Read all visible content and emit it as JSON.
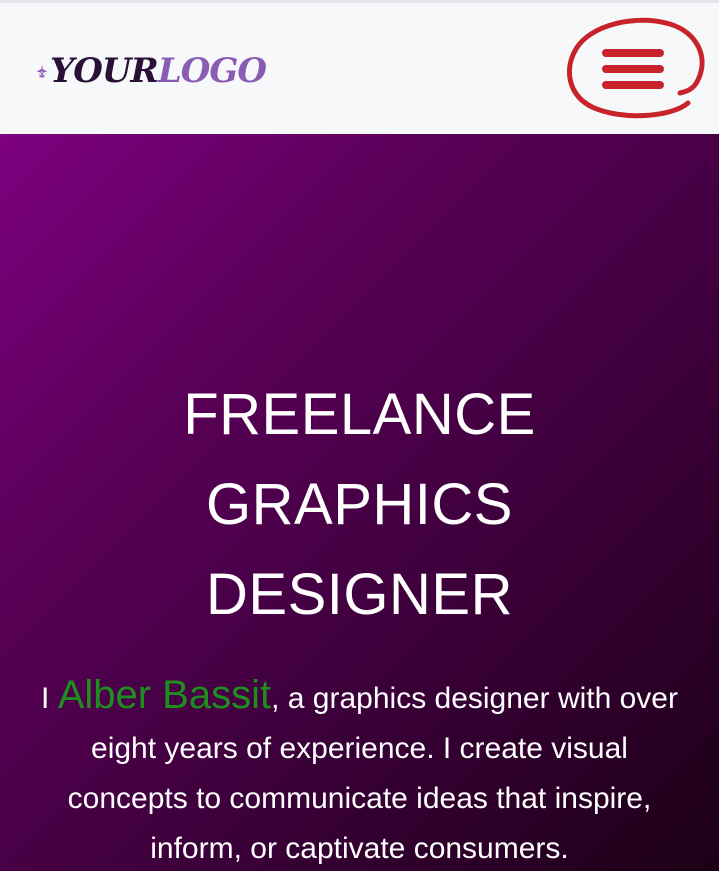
{
  "header": {
    "logo": {
      "part1": "YOUR",
      "part2": "LOGO"
    },
    "menu_icon": "hamburger-menu-icon",
    "menu_highlight_color": "#c8232b"
  },
  "hero": {
    "title_lines": [
      "FREELANCE",
      "GRAPHICS",
      "DESIGNER"
    ],
    "intro_prefix": "I ",
    "name": "Alber Bassit",
    "intro_rest": ", a graphics designer with over eight years of experience. I create visual concepts to communicate ideas that inspire, inform, or captivate consumers.",
    "name_color": "#1e8f1e"
  },
  "colors": {
    "header_bg": "#f7f8fa",
    "hero_gradient_start": "#7d0080",
    "hero_gradient_end": "#1c0016",
    "logo_dark": "#2a1036",
    "logo_light": "#8a5cb4"
  }
}
